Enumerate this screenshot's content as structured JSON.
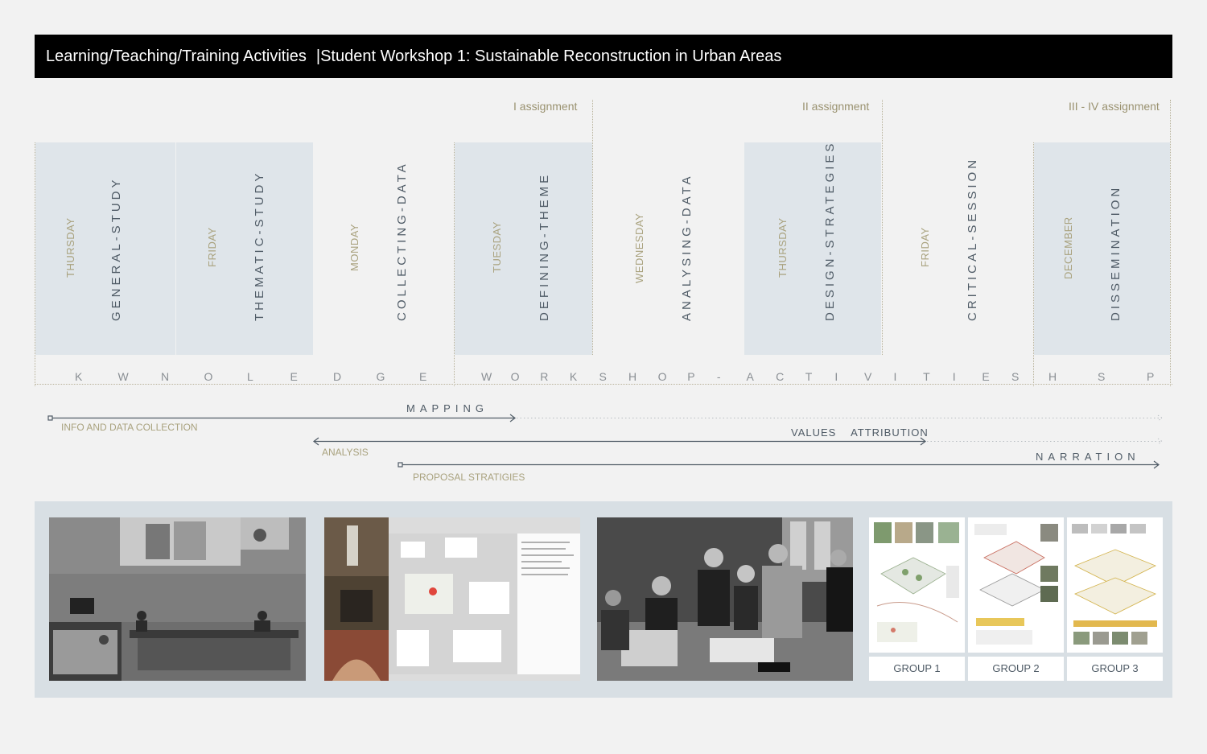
{
  "title": {
    "left": "Learning/Teaching/Training Activities",
    "right": "|Student Workshop 1: Sustainable Reconstruction in Urban Areas"
  },
  "assignments": [
    "I assignment",
    "II assignment",
    "III - IV assignment"
  ],
  "columns": [
    {
      "day": "THURSDAY",
      "activity": "GENERAL-STUDY"
    },
    {
      "day": "FRIDAY",
      "activity": "THEMATIC-STUDY"
    },
    {
      "day": "MONDAY",
      "activity": "COLLECTING-DATA"
    },
    {
      "day": "TUESDAY",
      "activity": "DEFINING-THEME"
    },
    {
      "day": "WEDNESDAY",
      "activity": "ANALYSING-DATA"
    },
    {
      "day": "THURSDAY",
      "activity": "DESIGN-STRATEGIES"
    },
    {
      "day": "FRIDAY",
      "activity": "CRITICAL-SESSION"
    },
    {
      "day": "DECEMBER",
      "activity": "DISSEMINATION"
    }
  ],
  "letter_rows": {
    "knowledge": [
      "K",
      "W",
      "N",
      "O",
      "L",
      "E",
      "D",
      "G",
      "E"
    ],
    "workshop": [
      "W",
      "O",
      "R",
      "K",
      "S",
      "H",
      "O",
      "P",
      "-",
      "A",
      "C",
      "T",
      "I",
      "V",
      "I",
      "T",
      "I",
      "E",
      "S"
    ],
    "hsp": [
      "H",
      "S",
      "P"
    ]
  },
  "arrows": {
    "mapping": "MAPPING",
    "mapping_sub": "INFO AND DATA COLLECTION",
    "values": "VALUES    ATTRIBUTION",
    "values_sub": "ANALYSIS",
    "narration": "NARRATION",
    "narration_sub": "PROPOSAL STRATIGIES"
  },
  "groups": [
    "GROUP 1",
    "GROUP 2",
    "GROUP 3"
  ],
  "colors": {
    "title_bg": "#000000",
    "column_shade": "#dfe5ea",
    "day_text": "#a9a27e",
    "activity_text": "#4f5b66",
    "gallery_bg": "#d8dfe4"
  },
  "icons": [
    "lecture-photo",
    "gis-map-screenshot",
    "workshop-photo",
    "poster-thumbnail"
  ]
}
